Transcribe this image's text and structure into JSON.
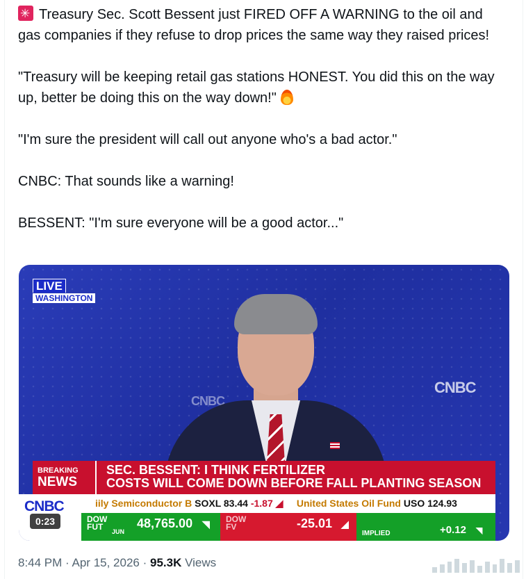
{
  "tweet": {
    "line1": "Treasury Sec. Scott Bessent just FIRED OFF A WARNING to the oil and gas companies if they refuse to drop prices the same way they raised prices!",
    "line2": "\"Treasury will be keeping retail gas stations HONEST. You did this on the way up, better be doing this on the way down!\"",
    "line3": "\"I'm sure the president will call out anyone who's a bad actor.\"",
    "line4": "CNBC: That sounds like a warning!",
    "line5": "BESSENT: \"I'm sure everyone will be a good actor...\""
  },
  "video": {
    "live": "LIVE",
    "location": "WASHINGTON",
    "wall_logo": "CNBC",
    "breaking_top": "BREAKING",
    "breaking_bottom": "NEWS",
    "headline_1": "SEC. BESSENT: I THINK FERTILIZER",
    "headline_2": "COSTS WILL COME DOWN BEFORE FALL PLANTING SEASON",
    "logo": "CNBC",
    "ticker_name_1": "iily Semiconductor B",
    "ticker_sym_1": "SOXL 83.44",
    "ticker_chg_1": "-1.87",
    "ticker_name_2": "United States Oil Fund",
    "ticker_sym_2": "USO 124.93",
    "dow_fut_label_1": "DOW",
    "dow_fut_label_2": "FUT",
    "dow_fut_month": "JUN",
    "dow_fut_value": "48,765.00",
    "dow_fv_label_1": "DOW",
    "dow_fv_label_2": "FV",
    "dow_fv_value": "-25.01",
    "implied_label": "IMPLIED",
    "implied_value": "+0.12",
    "time": "0:23"
  },
  "meta": {
    "time": "8:44 PM",
    "sep1": "·",
    "date": "Apr 15, 2026",
    "sep2": "·",
    "views": "95.3K",
    "views_label": "Views"
  }
}
